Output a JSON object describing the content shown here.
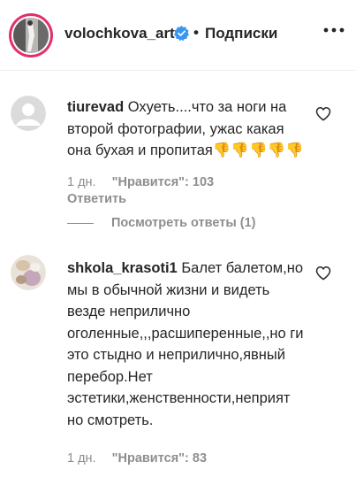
{
  "header": {
    "username": "volochkova_art",
    "separator": "•",
    "follow_label": "Подписки",
    "verified_icon": "verified-badge-icon",
    "more_icon": "more-options-icon"
  },
  "comments": [
    {
      "username": "tiurevad",
      "text": "Охуеть....что за ноги на второй фотографии, ужас какая она бухая и пропитая👎👎👎👎👎",
      "time": "1 дн.",
      "likes": "\"Нравится\": 103",
      "reply_label": "Ответить",
      "view_replies": "Посмотреть ответы (1)"
    },
    {
      "username": "shkola_krasoti1",
      "text": "Балет балетом,но мы в обычной жизни и видеть везде неприлично оголенные,,,расшиперенные,,но ги это стыдно и неприлично,явный перебор.Нет эстетики,женственности,неприят но смотреть.",
      "time": "1 дн.",
      "likes": "\"Нравится\": 83"
    }
  ],
  "colors": {
    "text": "#262626",
    "muted": "#8e8e8e",
    "verified": "#3897f0",
    "divider": "#efefef"
  }
}
